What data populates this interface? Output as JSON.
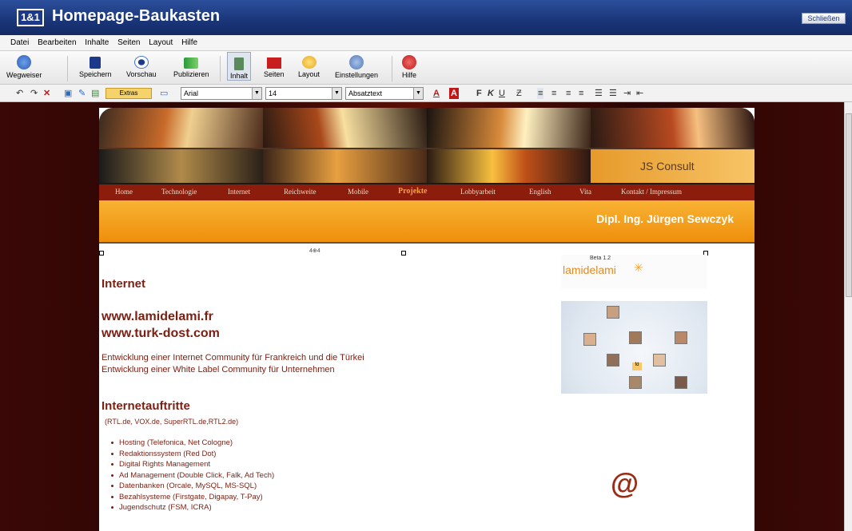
{
  "app": {
    "logo": "1&1",
    "title": "Homepage-Baukasten",
    "close_label": "Schließen"
  },
  "menu": [
    "Datei",
    "Bearbeiten",
    "Inhalte",
    "Seiten",
    "Layout",
    "Hilfe"
  ],
  "toolbar": {
    "wegweiser": "Wegweiser",
    "speichern": "Speichern",
    "vorschau": "Vorschau",
    "publizieren": "Publizieren",
    "inhalt": "Inhalt",
    "seiten": "Seiten",
    "layout": "Layout",
    "einstellungen": "Einstellungen",
    "hilfe": "Hilfe"
  },
  "format": {
    "extras": "Extras",
    "font": "Arial",
    "size": "14",
    "style": "Absatztext"
  },
  "site": {
    "logo": "JS Consult",
    "nav": [
      "Home",
      "Technologie",
      "Internet",
      "Reichweite",
      "Mobile",
      "Projekte",
      "Lobbyarbeit",
      "English",
      "Vita",
      "Kontakt / Impressum"
    ],
    "owner": "Dipl. Ing. Jürgen Sewczyk",
    "heading_internet": "Internet",
    "url1": "www.lamidelami.fr",
    "url2": "www.turk-dost.com",
    "desc1": "Entwicklung einer Internet Community für Frankreich und die Türkei",
    "desc2": "Entwicklung einer White Label Community für Unternehmen",
    "heading_web": "Internetauftritte",
    "paren": "(RTL.de, VOX.de, SuperRTL.de,RTL2.de)",
    "bullets": [
      "Hosting (Telefonica, Net Cologne)",
      "Redaktionssystem (Red Dot)",
      "Digital Rights Management",
      "Ad Management (Double Click, Falk, Ad Tech)",
      "Datenbanken (Orcale, MySQL, MS-SQL)",
      "Bezahlsysteme (Firstgate, Digapay, T-Pay)",
      "Jugendschutz (FSM, ICRA)"
    ],
    "lami_beta": "Beta 1.2",
    "lami_brand": "lamidelami",
    "lami_map_badge": "fd",
    "at": "@",
    "mid_marker": "4⊕4"
  }
}
